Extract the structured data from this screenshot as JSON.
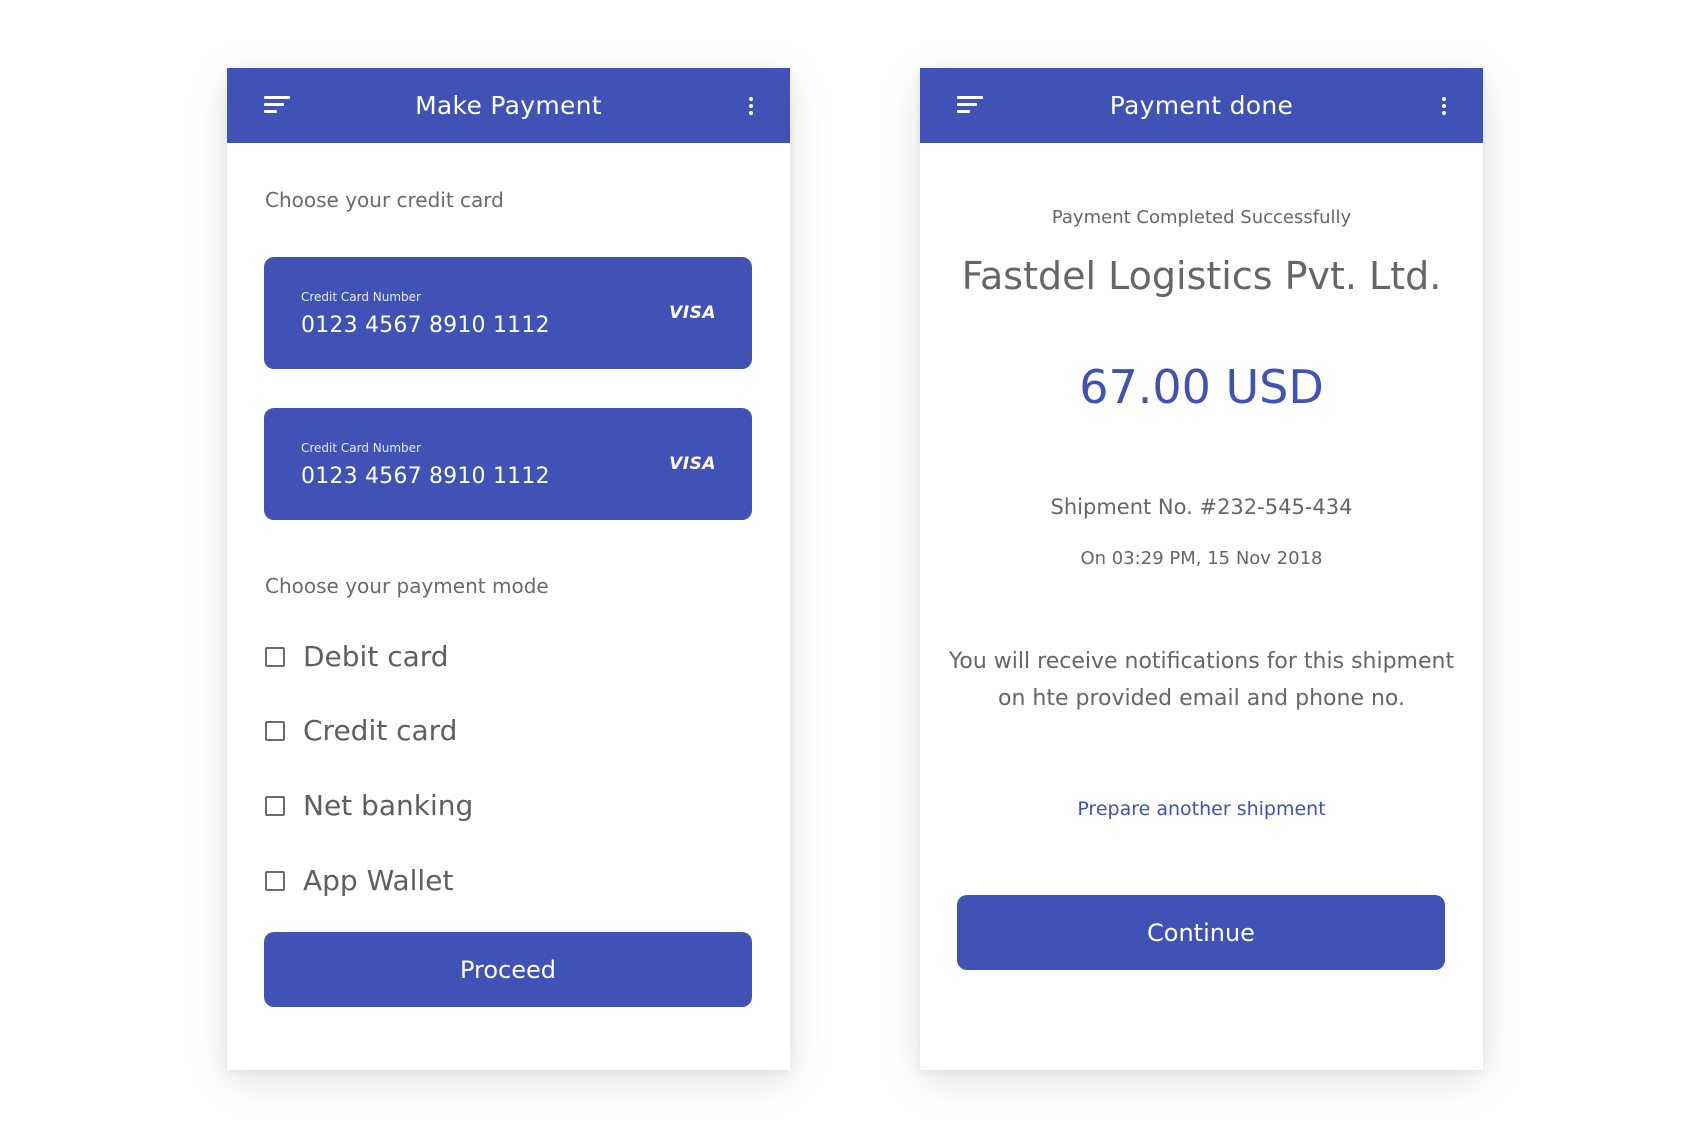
{
  "payment_screen": {
    "title": "Make Payment",
    "card_section_label": "Choose your credit card",
    "cards": [
      {
        "caption": "Credit Card Number",
        "number": "0123 4567 8910 1112",
        "brand": "VISA"
      },
      {
        "caption": "Credit Card Number",
        "number": "0123 4567 8910 1112",
        "brand": "VISA"
      }
    ],
    "mode_section_label": "Choose your payment mode",
    "modes": [
      {
        "label": "Debit card",
        "checked": false
      },
      {
        "label": "Credit card",
        "checked": false
      },
      {
        "label": "Net banking",
        "checked": false
      },
      {
        "label": "App Wallet",
        "checked": false
      }
    ],
    "proceed_label": "Proceed"
  },
  "done_screen": {
    "title": "Payment done",
    "status": "Payment Completed Successfully",
    "company": "Fastdel Logistics Pvt. Ltd.",
    "amount": "67.00 USD",
    "shipment": "Shipment No. #232-545-434",
    "datetime": "On 03:29 PM, 15 Nov 2018",
    "notice_line1": "You will receive notifications for this shipment",
    "notice_line2": "on hte provided email and phone no.",
    "link_label": "Prepare another shipment",
    "continue_label": "Continue"
  },
  "icons": {
    "menu": "menu-icon",
    "more": "more-vert-icon",
    "checkbox": "checkbox-unchecked-icon"
  },
  "colors": {
    "primary": "#4052b5",
    "text": "#666666",
    "background": "#ffffff"
  }
}
